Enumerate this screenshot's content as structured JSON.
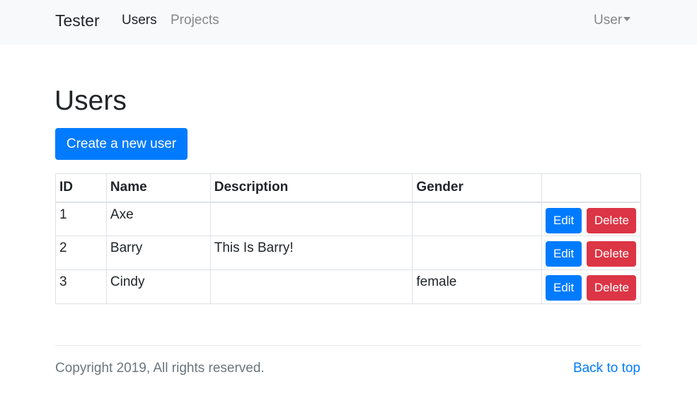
{
  "navbar": {
    "brand": "Tester",
    "links": [
      {
        "label": "Users",
        "active": true
      },
      {
        "label": "Projects",
        "active": false
      }
    ],
    "user_menu_label": "User",
    "user_menu_icon": "caret-down-icon"
  },
  "main": {
    "title": "Users",
    "create_button_label": "Create a new user",
    "table": {
      "columns": [
        "ID",
        "Name",
        "Description",
        "Gender",
        ""
      ],
      "rows": [
        {
          "id": "1",
          "name": "Axe",
          "description": "",
          "gender": ""
        },
        {
          "id": "2",
          "name": "Barry",
          "description": "This Is Barry!",
          "gender": ""
        },
        {
          "id": "3",
          "name": "Cindy",
          "description": "",
          "gender": "female"
        }
      ],
      "edit_label": "Edit",
      "delete_label": "Delete"
    }
  },
  "footer": {
    "copyright": "Copyright 2019, All rights reserved.",
    "back_to_top": "Back to top"
  },
  "colors": {
    "primary": "#007bff",
    "danger": "#dc3545",
    "navbar_bg": "#f8f9fa",
    "muted_text": "#6c757d"
  }
}
